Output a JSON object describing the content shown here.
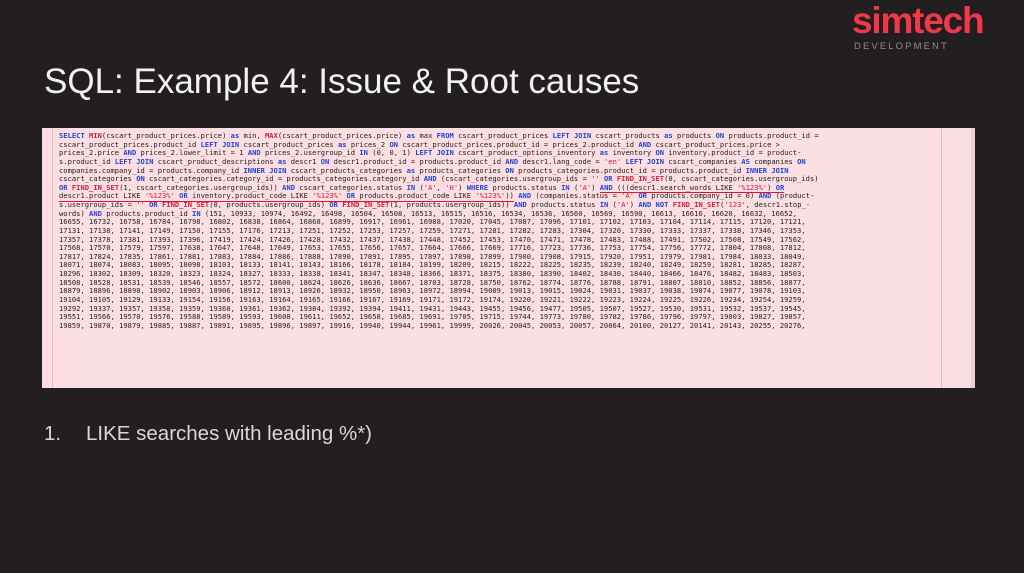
{
  "slide": {
    "background_color": "#231f20",
    "title": "SQL: Example 4: Issue & Root causes"
  },
  "logo": {
    "word": "simtech",
    "subtitle": "DEVELOPMENT",
    "word_color": "#f0384b",
    "subtitle_color": "#8d8d8d"
  },
  "code_block": {
    "background_color": "#fadee1",
    "keyword_color": "#1f44d8",
    "function_color": "#d01f3c",
    "string_color": "#d01f3c",
    "underline_color": "#e8112d",
    "language": "sql",
    "lines": [
      "SELECT MIN(cscart_product_prices.price) as min, MAX(cscart_product_prices.price) as max FROM cscart_product_prices LEFT JOIN cscart_products as products ON products.product_id =",
      "cscart_product_prices.product_id LEFT JOIN cscart_product_prices as prices_2 ON cscart_product_prices.product_id = prices_2.product_id AND cscart_product_prices.price >",
      "prices_2.price AND prices_2.lower_limit = 1 AND prices_2.usergroup_id IN (0, 0, 1) LEFT JOIN cscart_product_options_inventory as inventory ON inventory.product_id = product-",
      "s.product_id LEFT JOIN cscart_product_descriptions as descr1 ON descr1.product_id = products.product_id AND descr1.lang_code = 'en' LEFT JOIN cscart_companies AS companies ON",
      "companies.company_id = products.company_id INNER JOIN cscart_products_categories as products_categories ON products_categories.product_id = products.product_id INNER JOIN",
      "cscart_categories ON cscart_categories.category_id = products_categories.category_id AND (cscart_categories.usergroup_ids = '' OR FIND_IN_SET(0, cscart_categories.usergroup_ids)",
      "OR FIND_IN_SET(1, cscart_categories.usergroup_ids)) AND cscart_categories.status IN ('A', 'H') WHERE products.status IN ('A') AND (((descr1.search_words LIKE '%123%') OR",
      "descr1.product LIKE '%123%' OR inventory.product_code LIKE '%123%' OR products.product_code LIKE '%123%')) AND (companies.status = 'A' OR products.company_id = 0) AND (product-",
      "s.usergroup_ids = '' OR FIND_IN_SET(0, products.usergroup_ids) OR FIND_IN_SET(1, products.usergroup_ids)) AND products.status IN ('A') AND NOT FIND_IN_SET('123', descr1.stop_-",
      "words) AND products.product_id IN (151, 10933, 10974, 16492, 16498, 16504, 16508, 16513, 16515, 16516, 16534, 16536, 16560, 16569, 16590, 16613, 16616, 16620, 16632, 16652,",
      "16655, 16732, 16758, 16784, 16798, 16802, 16838, 16864, 16868, 16899, 16917, 16961, 16988, 17020, 17045, 17087, 17096, 17101, 17102, 17103, 17104, 17114, 17115, 17120, 17121,",
      "17131, 17138, 17141, 17149, 17150, 17155, 17176, 17213, 17251, 17252, 17253, 17257, 17259, 17271, 17281, 17282, 17283, 17304, 17320, 17330, 17333, 17337, 17338, 17346, 17353,",
      "17357, 17378, 17381, 17393, 17396, 17419, 17424, 17426, 17428, 17432, 17437, 17438, 17448, 17452, 17453, 17470, 17471, 17478, 17483, 17488, 17491, 17502, 17508, 17549, 17562,",
      "17568, 17570, 17579, 17597, 17638, 17647, 17648, 17649, 17653, 17655, 17656, 17657, 17664, 17666, 17669, 17716, 17723, 17736, 17753, 17754, 17756, 17772, 17804, 17808, 17812,",
      "17817, 17824, 17835, 17861, 17881, 17883, 17884, 17886, 17888, 17890, 17891, 17895, 17897, 17898, 17899, 17900, 17908, 17915, 17920, 17951, 17979, 17981, 17984, 18033, 18049,",
      "18071, 18074, 18083, 18095, 18098, 18103, 18133, 18141, 18143, 18166, 18178, 18184, 18199, 18209, 18215, 18222, 18225, 18235, 18239, 18240, 18249, 18259, 18281, 18285, 18287,",
      "18296, 18302, 18309, 18320, 18323, 18324, 18327, 18333, 18338, 18341, 18347, 18348, 18366, 18371, 18375, 18380, 18390, 18402, 18430, 18440, 18466, 18476, 18482, 18483, 18503,",
      "18508, 18528, 18531, 18539, 18546, 18557, 18572, 18600, 18624, 18626, 18636, 18667, 18703, 18728, 18750, 18762, 18774, 18776, 18788, 18791, 18807, 18810, 18852, 18856, 18877,",
      "18879, 18896, 18898, 18902, 18903, 18906, 18912, 18913, 18926, 18932, 18950, 18963, 18972, 18994, 19009, 19013, 19015, 19024, 19031, 19037, 19038, 19074, 19077, 19078, 19103,",
      "19104, 19105, 19129, 19133, 19154, 19156, 19163, 19164, 19165, 19166, 19167, 19169, 19171, 19172, 19174, 19220, 19221, 19222, 19223, 19224, 19225, 19226, 19234, 19254, 19259,",
      "19292, 19337, 19357, 19358, 19359, 19360, 19361, 19362, 19384, 19392, 19394, 19411, 19431, 19443, 19455, 19456, 19477, 19505, 19507, 19527, 19530, 19531, 19532, 19537, 19545,",
      "19551, 19566, 19570, 19576, 19588, 19589, 19593, 19608, 19611, 19652, 19658, 19685, 19691, 19705, 19715, 19744, 19773, 19780, 19782, 19786, 19796, 19797, 19803, 19827, 19857,",
      "19859, 19870, 19879, 19885, 19887, 19891, 19895, 19896, 19897, 19916, 19940, 19944, 19961, 19999, 20026, 20045, 20053, 20057, 20064, 20100, 20127, 20141, 20143, 20255, 20276,"
    ],
    "highlighted_fragment": "AND (((descr1.search_words LIKE '%123%') OR descr1.product LIKE '%123%' OR inventory.product_code LIKE '%123%' OR products.product_code LIKE '%123%'))"
  },
  "bullets": [
    {
      "number": "1.",
      "text": "LIKE searches with leading %*)"
    }
  ]
}
